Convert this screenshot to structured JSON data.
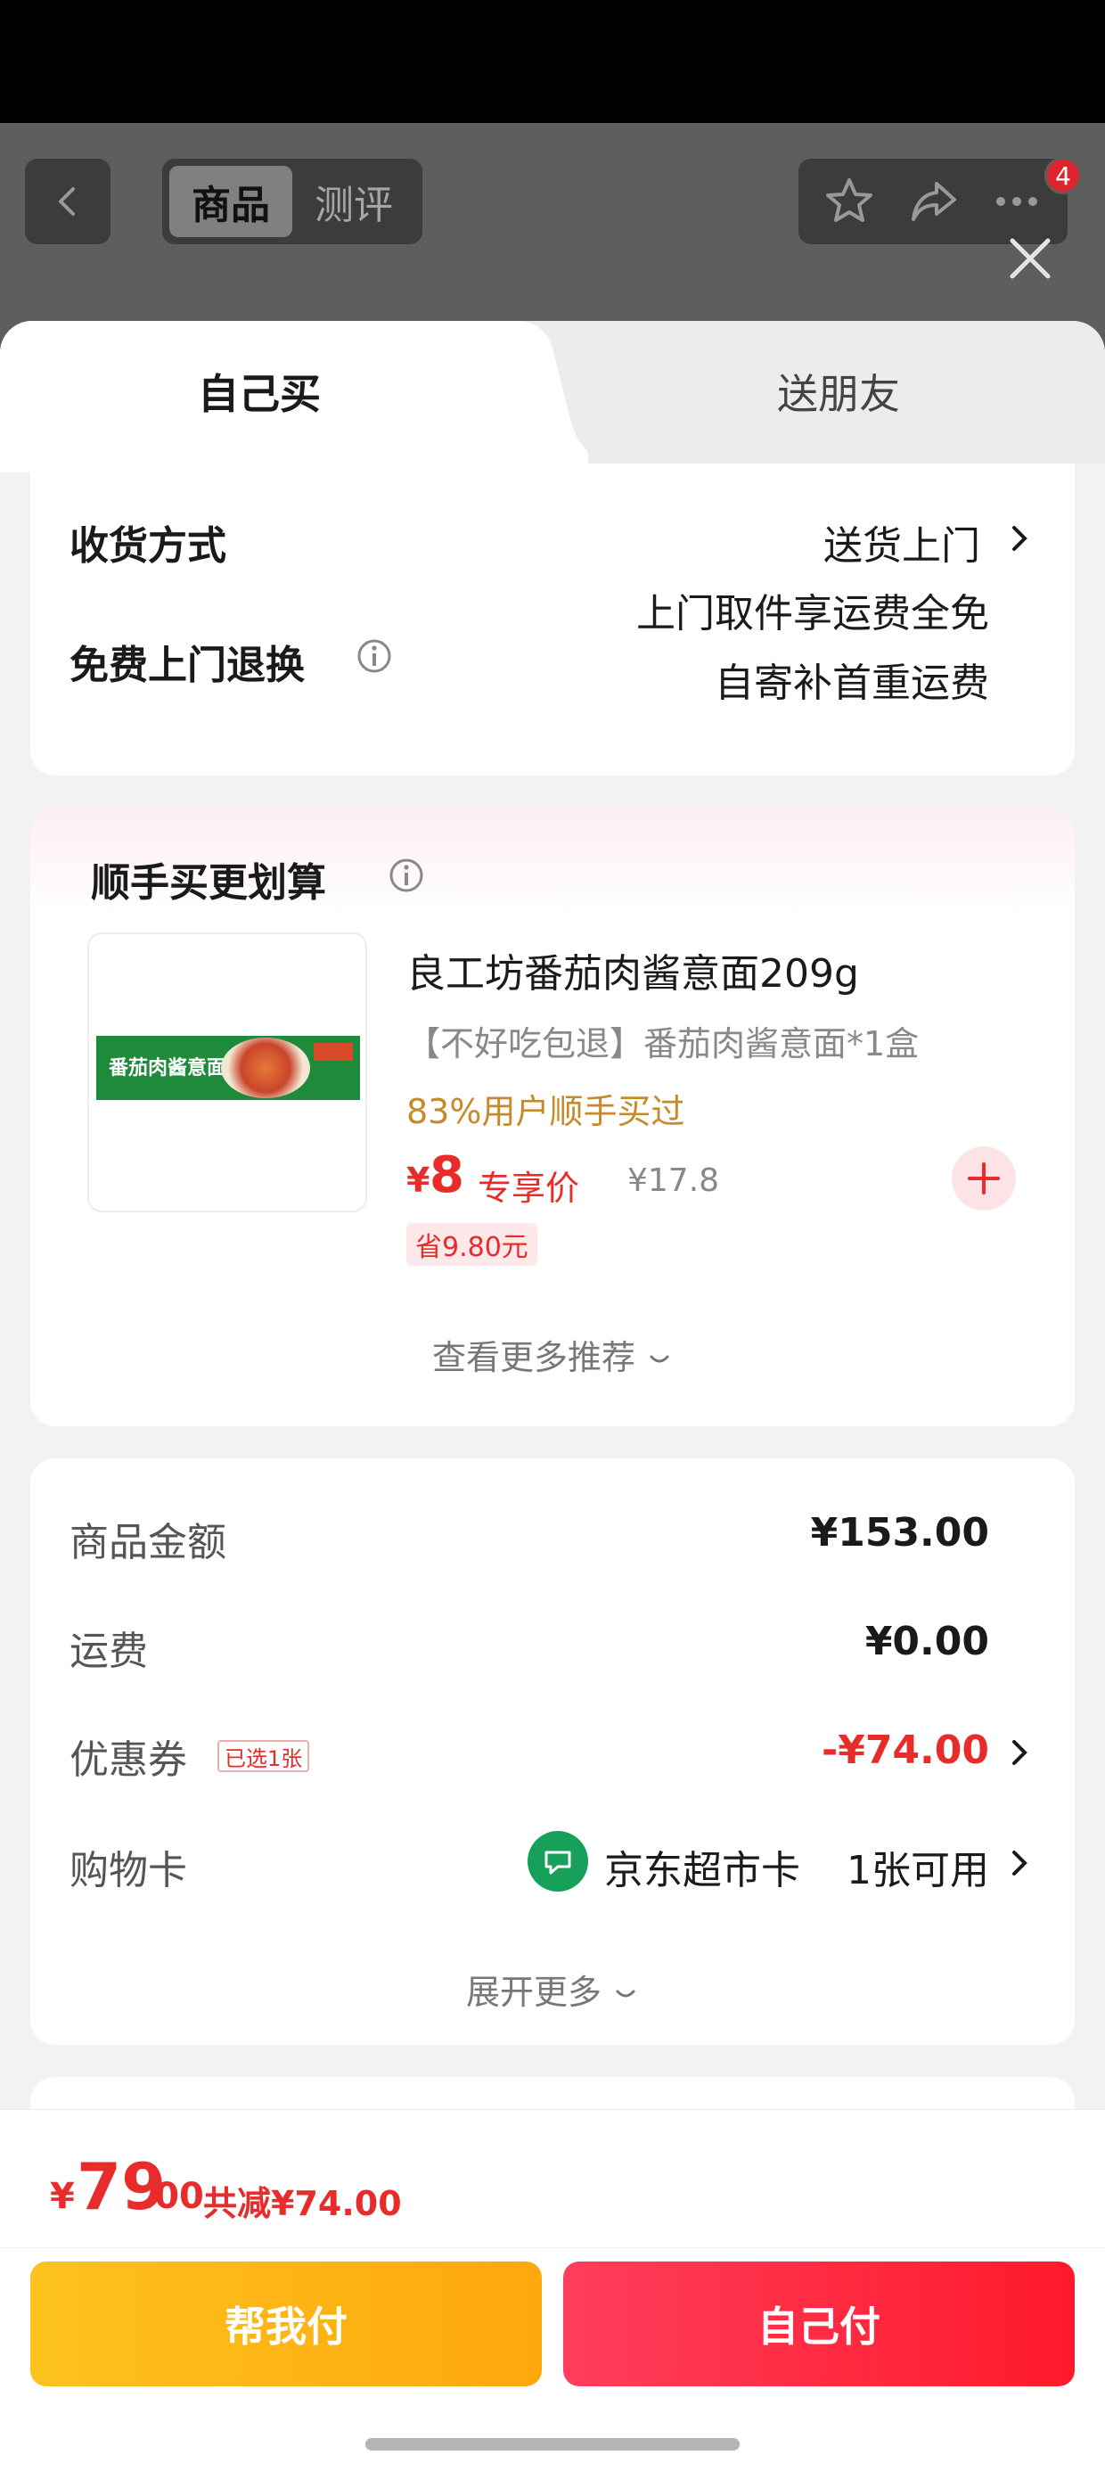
{
  "header": {
    "tabs": [
      {
        "label": "商品"
      },
      {
        "label": "测评"
      }
    ],
    "badge_count": "4"
  },
  "sheet": {
    "tabs": [
      {
        "label": "自己买"
      },
      {
        "label": "送朋友"
      }
    ]
  },
  "delivery": {
    "label": "收货方式",
    "value": "送货上门",
    "return_label": "免费上门退换",
    "return_line1": "上门取件享运费全免",
    "return_line2": "自寄补首重运费"
  },
  "addon": {
    "title": "顺手买更划算",
    "product": {
      "name": "良工坊番茄肉酱意面209g",
      "desc": "【不好吃包退】番茄肉酱意面*1盒",
      "pct": "83%用户顺手买过",
      "currency": "¥",
      "price": "8",
      "price_tag": "专享价",
      "orig_price": "¥17.8",
      "save": "省9.80元",
      "package_text": "番茄肉酱意面"
    },
    "more": "查看更多推荐"
  },
  "fees": {
    "rows": [
      {
        "label": "商品金额",
        "value": "¥153.00"
      },
      {
        "label": "运费",
        "value": "¥0.00"
      },
      {
        "label": "优惠券",
        "tag": "已选1张",
        "value": "-¥74.00"
      },
      {
        "label": "购物卡",
        "card_name": "京东超市卡",
        "value": "1张可用"
      }
    ],
    "expand": "展开更多"
  },
  "footer": {
    "currency": "¥",
    "total_int": "79",
    "total_dec": ".00",
    "saved": "共减¥74.00",
    "help_btn": "帮我付",
    "pay_btn": "自己付"
  },
  "colors": {
    "accent_red": "#e82b2b",
    "help_yellow": "#fdc21e",
    "pay_red": "#ff1a2a"
  }
}
